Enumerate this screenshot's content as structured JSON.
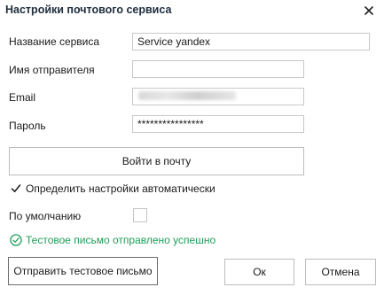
{
  "window": {
    "title": "Настройки почтового сервиса",
    "close_icon": "close-icon"
  },
  "form": {
    "service_name_label": "Название сервиса",
    "service_name_value": "Service yandex",
    "sender_name_label": "Имя отправителя",
    "sender_name_value": "",
    "email_label": "Email",
    "password_label": "Пароль",
    "password_value": "****************"
  },
  "buttons": {
    "login": "Войти в почту",
    "send_test": "Отправить тестовое письмо",
    "ok": "Ок",
    "cancel": "Отмена"
  },
  "options": {
    "auto_settings_label": "Определить настройки автоматически",
    "auto_settings_checked": true,
    "default_label": "По умолчанию",
    "default_checked": false
  },
  "status": {
    "message": "Тестовое письмо отправлено успешно",
    "icon": "check-circle-icon",
    "color": "#1f9e5a"
  }
}
